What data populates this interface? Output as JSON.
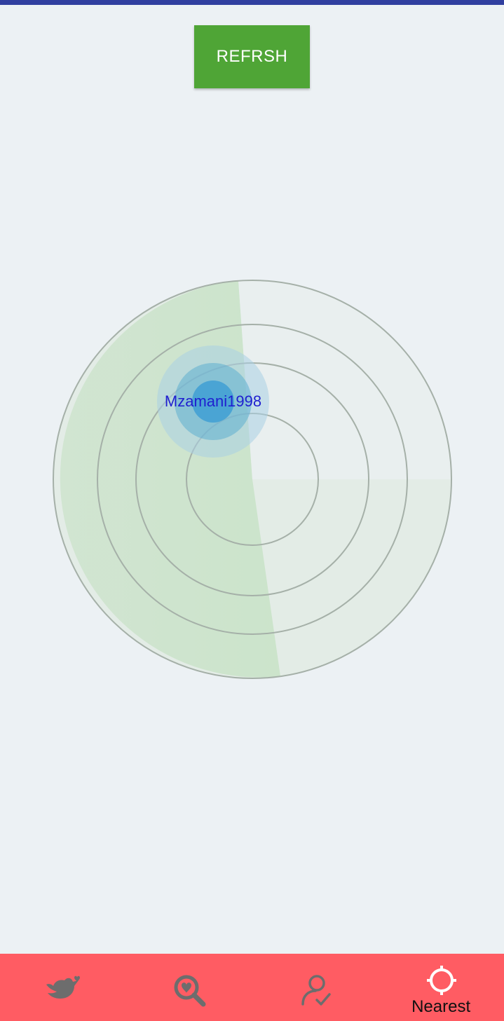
{
  "header": {
    "refresh_label": "REFRSH"
  },
  "radar": {
    "user_label": "Mzamani1998"
  },
  "bottom_nav": {
    "items": [
      {
        "icon": "bird-heart-icon",
        "label": ""
      },
      {
        "icon": "heart-search-icon",
        "label": ""
      },
      {
        "icon": "user-check-icon",
        "label": ""
      },
      {
        "icon": "crosshair-icon",
        "label": "Nearest",
        "active": true
      }
    ]
  },
  "colors": {
    "top_bar": "#303f9f",
    "refresh_button": "#4fa536",
    "bottom_nav": "#ff5c63",
    "user_label": "#1f1fd0",
    "inactive_icon": "#6d6d6d",
    "active_icon": "#ffffff"
  }
}
